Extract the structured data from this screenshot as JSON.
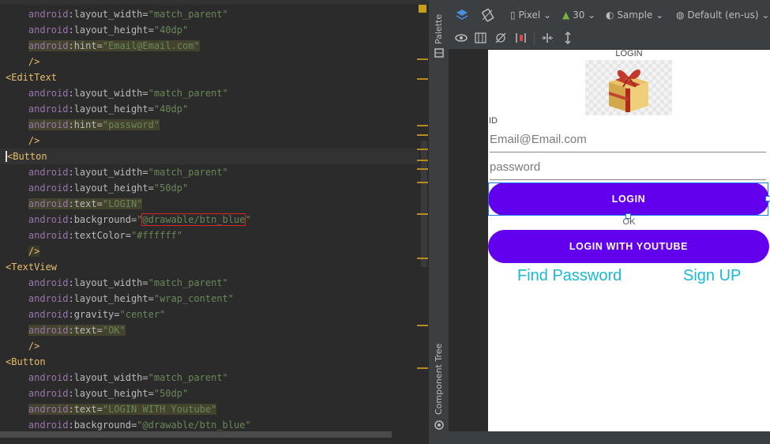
{
  "editor": {
    "lines": [
      {
        "indent": true,
        "parts": [
          {
            "t": "android",
            "c": "ns"
          },
          {
            "t": ":layout_width=",
            "c": "attr"
          },
          {
            "t": "\"match_parent\"",
            "c": "val"
          }
        ]
      },
      {
        "indent": true,
        "parts": [
          {
            "t": "android",
            "c": "ns"
          },
          {
            "t": ":layout_height=",
            "c": "attr"
          },
          {
            "t": "\"40dp\"",
            "c": "val"
          }
        ]
      },
      {
        "indent": true,
        "parts": [
          {
            "t": "android",
            "c": "ns hl2"
          },
          {
            "t": ":hint=",
            "c": "attr hl2"
          },
          {
            "t": "\"Email@Email.com\"",
            "c": "val hl2"
          }
        ]
      },
      {
        "indent": true,
        "parts": [
          {
            "t": "/>",
            "c": "tag"
          }
        ]
      },
      {
        "indent": false,
        "parts": [
          {
            "t": "<EditText",
            "c": "tag"
          }
        ]
      },
      {
        "indent": true,
        "parts": [
          {
            "t": "android",
            "c": "ns"
          },
          {
            "t": ":layout_width=",
            "c": "attr"
          },
          {
            "t": "\"match_parent\"",
            "c": "val"
          }
        ]
      },
      {
        "indent": true,
        "parts": [
          {
            "t": "android",
            "c": "ns"
          },
          {
            "t": ":layout_height=",
            "c": "attr"
          },
          {
            "t": "\"40dp\"",
            "c": "val"
          }
        ]
      },
      {
        "indent": true,
        "parts": [
          {
            "t": "android",
            "c": "ns hl2"
          },
          {
            "t": ":hint=",
            "c": "attr hl2"
          },
          {
            "t": "\"password\"",
            "c": "val hl2"
          }
        ]
      },
      {
        "indent": true,
        "parts": [
          {
            "t": "/>",
            "c": "tag"
          }
        ]
      },
      {
        "indent": false,
        "current": true,
        "parts": [
          {
            "t": "<",
            "c": "tag caret"
          },
          {
            "t": "Button",
            "c": "tag"
          }
        ]
      },
      {
        "indent": true,
        "parts": [
          {
            "t": "android",
            "c": "ns"
          },
          {
            "t": ":layout_width=",
            "c": "attr"
          },
          {
            "t": "\"match_parent\"",
            "c": "val"
          }
        ]
      },
      {
        "indent": true,
        "parts": [
          {
            "t": "android",
            "c": "ns"
          },
          {
            "t": ":layout_height=",
            "c": "attr"
          },
          {
            "t": "\"50dp\"",
            "c": "val"
          }
        ]
      },
      {
        "indent": true,
        "parts": [
          {
            "t": "android",
            "c": "ns hl2"
          },
          {
            "t": ":text=",
            "c": "attr hl2"
          },
          {
            "t": "\"LOGIN\"",
            "c": "val hl2"
          }
        ]
      },
      {
        "indent": true,
        "parts": [
          {
            "t": "android",
            "c": "ns"
          },
          {
            "t": ":background=",
            "c": "attr"
          },
          {
            "t": "\"",
            "c": "val"
          },
          {
            "t": "@drawable/btn_blue",
            "c": "val boxed"
          },
          {
            "t": "\"",
            "c": "val"
          }
        ]
      },
      {
        "indent": true,
        "parts": [
          {
            "t": "android",
            "c": "ns"
          },
          {
            "t": ":textColor=",
            "c": "attr"
          },
          {
            "t": "\"#ffffff\"",
            "c": "val"
          }
        ]
      },
      {
        "indent": true,
        "parts": [
          {
            "t": "/>",
            "c": "tag hl"
          }
        ]
      },
      {
        "indent": false,
        "parts": [
          {
            "t": "<TextView",
            "c": "tag"
          }
        ]
      },
      {
        "indent": true,
        "parts": [
          {
            "t": "android",
            "c": "ns"
          },
          {
            "t": ":layout_width=",
            "c": "attr"
          },
          {
            "t": "\"match_parent\"",
            "c": "val"
          }
        ]
      },
      {
        "indent": true,
        "parts": [
          {
            "t": "android",
            "c": "ns"
          },
          {
            "t": ":layout_height=",
            "c": "attr"
          },
          {
            "t": "\"wrap_content\"",
            "c": "val"
          }
        ]
      },
      {
        "indent": true,
        "parts": [
          {
            "t": "android",
            "c": "ns"
          },
          {
            "t": ":gravity=",
            "c": "attr"
          },
          {
            "t": "\"center\"",
            "c": "val"
          }
        ]
      },
      {
        "indent": true,
        "parts": [
          {
            "t": "android",
            "c": "ns hl2"
          },
          {
            "t": ":text=",
            "c": "attr hl2"
          },
          {
            "t": "\"OK\"",
            "c": "val hl2"
          }
        ]
      },
      {
        "indent": true,
        "parts": [
          {
            "t": "/>",
            "c": "tag"
          }
        ]
      },
      {
        "indent": false,
        "parts": [
          {
            "t": "<Button",
            "c": "tag"
          }
        ]
      },
      {
        "indent": true,
        "parts": [
          {
            "t": "android",
            "c": "ns"
          },
          {
            "t": ":layout_width=",
            "c": "attr"
          },
          {
            "t": "\"match_parent\"",
            "c": "val"
          }
        ]
      },
      {
        "indent": true,
        "parts": [
          {
            "t": "android",
            "c": "ns"
          },
          {
            "t": ":layout_height=",
            "c": "attr"
          },
          {
            "t": "\"50dp\"",
            "c": "val"
          }
        ]
      },
      {
        "indent": true,
        "parts": [
          {
            "t": "android",
            "c": "ns hl2"
          },
          {
            "t": ":text=",
            "c": "attr hl2"
          },
          {
            "t": "\"LOGIN WITH Youtube\"",
            "c": "val hl2"
          }
        ]
      },
      {
        "indent": true,
        "parts": [
          {
            "t": "android",
            "c": "ns"
          },
          {
            "t": ":background=",
            "c": "attr"
          },
          {
            "t": "\"@drawable/btn_blue\"",
            "c": "val"
          }
        ]
      }
    ]
  },
  "side_panel": {
    "palette_label": "Palette",
    "component_tree_label": "Component Tree"
  },
  "toolbar": {
    "device": "Pixel",
    "api": "30",
    "theme": "Sample",
    "locale": "Default (en-us)"
  },
  "preview": {
    "title": "LOGIN",
    "id_label": "ID",
    "email_hint": "Email@Email.com",
    "password_hint": "password",
    "login_button": "LOGIN",
    "ok_text": "OK",
    "youtube_button": "LOGIN WITH YOUTUBE",
    "find_password": "Find Password",
    "sign_up": "Sign UP"
  },
  "colors": {
    "button": "#6200ee",
    "link": "#18b9d6",
    "selection": "#1a73e8"
  },
  "icons": [
    "layers-icon",
    "rotate-icon",
    "phone-icon",
    "android-icon",
    "theme-icon",
    "globe-icon",
    "eye-icon",
    "blueprint-icon",
    "constraints-icon",
    "margin-icon",
    "pack-horizontal-icon",
    "pack-vertical-icon",
    "palette-icon",
    "component-tree-icon"
  ]
}
